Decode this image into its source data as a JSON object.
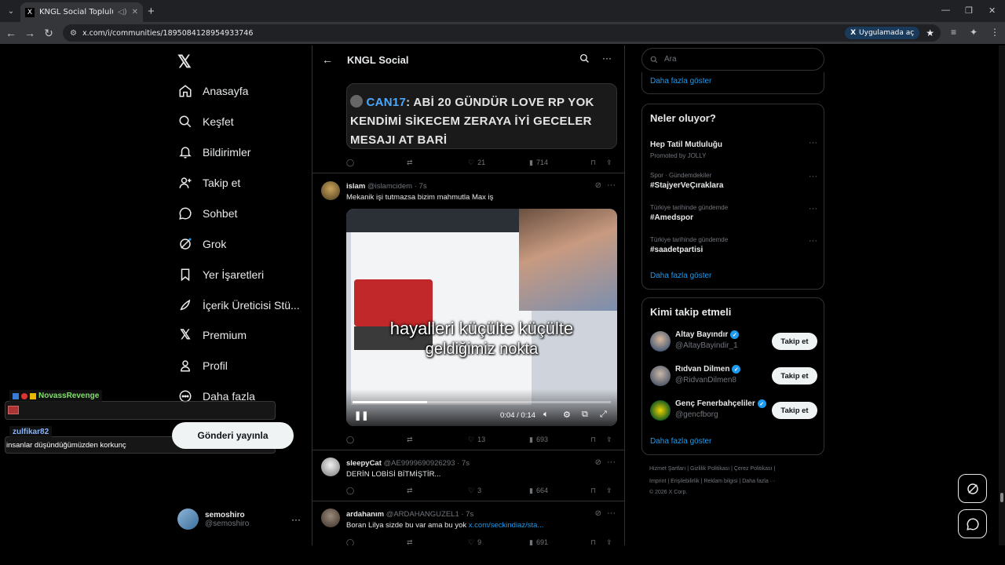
{
  "browser": {
    "tab_title": "KNGL Social Topluluk / X",
    "url": "x.com/i/communities/1895084128954933746",
    "open_in_app": "Uygulamada aç"
  },
  "nav": {
    "items": [
      {
        "label": "Anasayfa",
        "icon": "home-icon"
      },
      {
        "label": "Keşfet",
        "icon": "search-icon"
      },
      {
        "label": "Bildirimler",
        "icon": "bell-icon"
      },
      {
        "label": "Takip et",
        "icon": "person-add-icon"
      },
      {
        "label": "Sohbet",
        "icon": "chat-icon"
      },
      {
        "label": "Grok",
        "icon": "grok-icon"
      },
      {
        "label": "Yer İşaretleri",
        "icon": "bookmark-icon"
      },
      {
        "label": "İçerik Üreticisi Stü...",
        "icon": "rocket-icon"
      },
      {
        "label": "Premium",
        "icon": "x-logo-icon"
      },
      {
        "label": "Profil",
        "icon": "person-icon"
      },
      {
        "label": "Daha fazla",
        "icon": "more-circle-icon"
      }
    ],
    "publish": "Gönderi yayınla",
    "user": {
      "name": "semoshiro",
      "handle": "@semoshiro"
    }
  },
  "chat_overlay": {
    "user1": "NovassRevenge",
    "user2": "zulfikar82",
    "message2": "insanlar düşündüğümüzden korkunç"
  },
  "main": {
    "title": "KNGL Social",
    "quote": {
      "name": "CAN17",
      "text": ": ABİ 20 GÜNDÜR LOVE RP YOK KENDİMİ SİKECEM ZERAYA İYİ GECELER MESAJI AT BARİ"
    },
    "quote_stats": {
      "likes": "21",
      "views": "714"
    },
    "posts": [
      {
        "name": "islam",
        "handle": "@islamcidem · 7s",
        "text": "Mekanik işi tutmazsa bizim mahmutla Max iş",
        "video": {
          "caption1": "hayalleri küçülte küçülte",
          "caption2": "geldiğimiz nokta",
          "time": "0:04 / 0:14",
          "progress": 0.29
        },
        "likes": "13",
        "views": "693"
      },
      {
        "name": "sleepyCat",
        "handle": "@AE9999690926293 · 7s",
        "text": "DERİN LOBİSİ BİTMİŞTİR...",
        "likes": "3",
        "views": "664"
      },
      {
        "name": "ardahanım",
        "handle": "@ARDAHANGUZEL1 · 7s",
        "text": "Boran Lilya sizde bu var ama bu yok",
        "link": "x.com/seckindiaz/sta...",
        "likes": "9",
        "views": "691"
      }
    ]
  },
  "right": {
    "search_placeholder": "Ara",
    "show_more_top": "Daha fazla göster",
    "trends_title": "Neler oluyor?",
    "trends": [
      {
        "meta": "",
        "name": "Hep Tatil Mutluluğu",
        "promo": "Promoted by JOLLY"
      },
      {
        "meta": "Spor · Gündemdekiler",
        "name": "#StajyerVeÇıraklara"
      },
      {
        "meta": "Türkiye tarihinde gündemde",
        "name": "#Amedspor"
      },
      {
        "meta": "Türkiye tarihinde gündemde",
        "name": "#saadetpartisi"
      }
    ],
    "trends_more": "Daha fazla göster",
    "who_title": "Kimi takip etmeli",
    "who": [
      {
        "name": "Altay Bayındır",
        "handle": "@AltayBayindir_1",
        "button": "Takip et"
      },
      {
        "name": "Rıdvan Dilmen",
        "handle": "@RidvanDilmen8",
        "button": "Takip et"
      },
      {
        "name": "Genç Fenerbahçeliler",
        "handle": "@gencfborg",
        "button": "Takip et"
      }
    ],
    "who_more": "Daha fazla göster",
    "footer": {
      "line1": "Hizmet Şartları  |  Gizlilik Politikası  |  Çerez Politikası  |",
      "line2": "Imprint  |  Erişilebilirlik  |  Reklam bilgisi  |  Daha fazla ···",
      "line3": "© 2026 X Corp."
    }
  }
}
